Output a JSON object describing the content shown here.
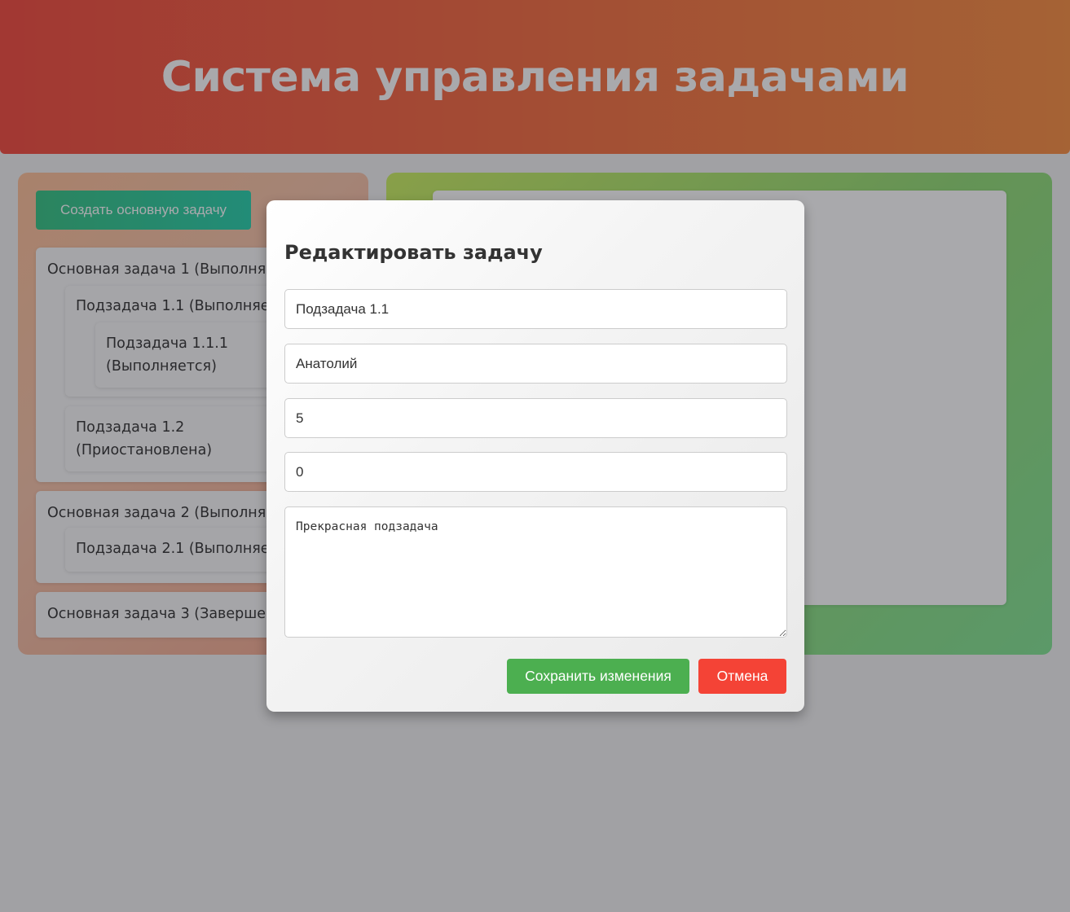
{
  "header": {
    "title": "Система управления задачами"
  },
  "left_panel": {
    "create_button": "Создать основную задачу",
    "tasks": {
      "t1": "Основная задача 1 (Выполняется)",
      "t1_1": "Подзадача 1.1 (Выполняется)",
      "t1_1_1": "Подзадача 1.1.1 (Выполняется)",
      "t1_2": "Подзадача 1.2 (Приостановлена)",
      "t2": "Основная задача 2 (Выполняется)",
      "t2_1": "Подзадача 2.1 (Выполняется)",
      "t3": "Основная задача 3 (Завершена)"
    }
  },
  "modal": {
    "title": "Редактировать задачу",
    "fields": {
      "name": "Подзадача 1.1",
      "assignee": "Анатолий",
      "field_3": "5",
      "field_4": "0",
      "description": "Прекрасная подзадача"
    },
    "save_button": "Сохранить изменения",
    "cancel_button": "Отмена"
  },
  "colors": {
    "save": "#4caf50",
    "cancel": "#f44336",
    "header_from": "#f44336",
    "header_to": "#f88a3a"
  }
}
